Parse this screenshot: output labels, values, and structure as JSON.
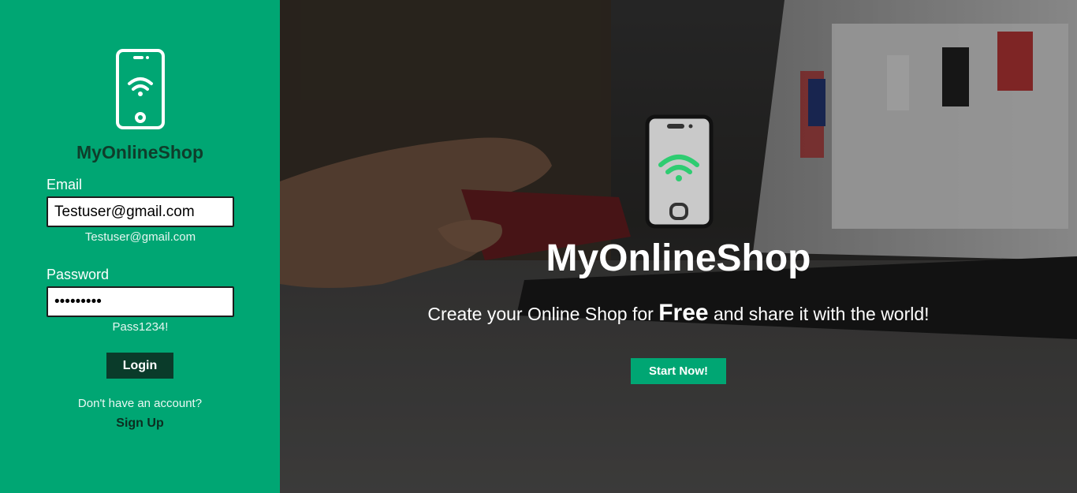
{
  "brand": {
    "name": "MyOnlineShop"
  },
  "login": {
    "email_label": "Email",
    "email_value": "Testuser@gmail.com",
    "email_hint": "Testuser@gmail.com",
    "password_label": "Password",
    "password_value": "Pass1234!",
    "password_hint": "Pass1234!",
    "login_button": "Login",
    "signup_prompt": "Don't have an account?",
    "signup_link": "Sign Up"
  },
  "hero": {
    "title": "MyOnlineShop",
    "subtitle_before": "Create your Online Shop for ",
    "subtitle_emphasis": "Free",
    "subtitle_after": " and share it with the world!",
    "cta": "Start Now!"
  },
  "colors": {
    "primary": "#00a673",
    "dark": "#0a3b2a",
    "wifi_green": "#2ecc71"
  },
  "icons": {
    "logo": "smartphone-wifi-icon",
    "hero": "smartphone-wifi-icon"
  }
}
